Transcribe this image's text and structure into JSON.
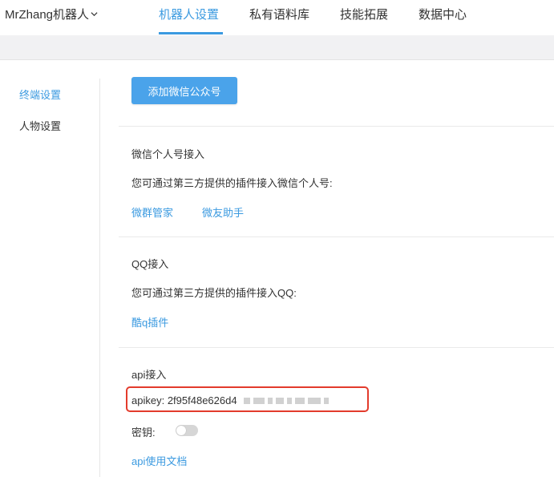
{
  "header": {
    "brand": "MrZhang机器人",
    "tabs": [
      {
        "label": "机器人设置",
        "active": true
      },
      {
        "label": "私有语料库",
        "active": false
      },
      {
        "label": "技能拓展",
        "active": false
      },
      {
        "label": "数据中心",
        "active": false
      }
    ]
  },
  "sidebar": {
    "items": [
      {
        "label": "终端设置",
        "active": true
      },
      {
        "label": "人物设置",
        "active": false
      }
    ]
  },
  "main": {
    "add_button": "添加微信公众号",
    "wechat_section": {
      "title": "微信个人号接入",
      "desc": "您可通过第三方提供的插件接入微信个人号:",
      "links": [
        "微群管家",
        "微友助手"
      ]
    },
    "qq_section": {
      "title": "QQ接入",
      "desc": "您可通过第三方提供的插件接入QQ:",
      "links": [
        "酷q插件"
      ]
    },
    "api_section": {
      "title": "api接入",
      "apikey_label": "apikey:",
      "apikey_value": "2f95f48e626d4",
      "secret_label": "密钥:",
      "secret_enabled": false,
      "doc_link": "api使用文档"
    }
  },
  "colors": {
    "accent": "#3b9ae0",
    "button": "#4aa3ea",
    "highlight_border": "#e33b2c"
  }
}
